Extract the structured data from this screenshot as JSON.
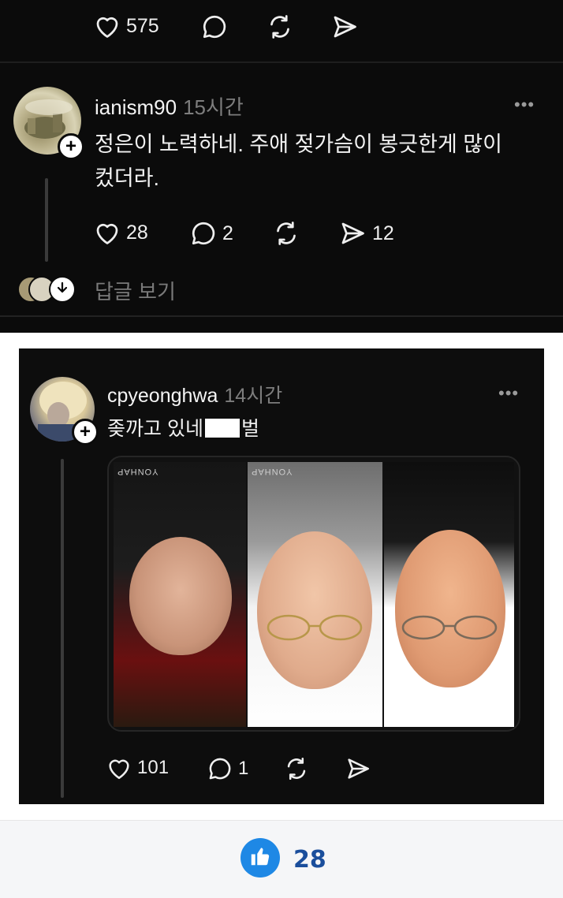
{
  "top_post": {
    "like_count": "575"
  },
  "comment1": {
    "username": "ianism90",
    "time": "15시간",
    "more": "•••",
    "text_line1": "정은이 노력하네. 주애 젖가슴이 봉긋한게 많이",
    "text_line2": "컸더라.",
    "like_count": "28",
    "reply_count": "2",
    "share_count": "12",
    "view_replies": "답글 보기"
  },
  "comment2": {
    "username": "cpyeonghwa",
    "time": "14시간",
    "more": "•••",
    "text_before": "좆까고 있네",
    "text_after": "벌",
    "like_count": "101",
    "reply_count": "1",
    "watermark": "YONHAP"
  },
  "footer": {
    "like_count": "28"
  },
  "icons": {
    "like": "heart-icon",
    "reply": "comment-bubble-icon",
    "repost": "repost-icon",
    "share": "send-icon",
    "follow": "plus-icon",
    "expand": "chevron-down-icon",
    "thumb": "thumbs-up-icon"
  },
  "colors": {
    "background_dark": "#0b0b0b",
    "text_primary": "#f2f2f2",
    "text_muted": "#7d7d7d",
    "like_button": "#1e88e5",
    "like_count": "#1a4e9c"
  }
}
